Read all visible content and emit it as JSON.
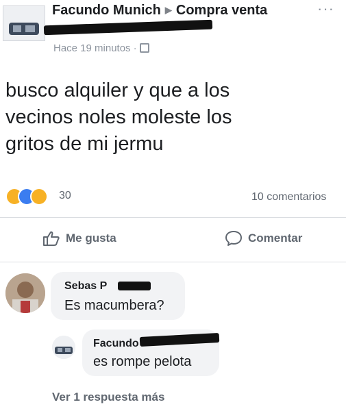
{
  "post": {
    "author": "Facundo Munich",
    "group": "Compra venta",
    "timestamp": "Hace 19 minutos",
    "separator": "·",
    "text_lines": [
      "busco alquiler y que a los",
      "vecinos noles moleste los",
      "gritos de mi jermu"
    ],
    "reaction_count": "30",
    "comments_count": "10 comentarios",
    "reactions": [
      "haha-icon",
      "like-icon",
      "wow-icon"
    ]
  },
  "actions": {
    "like_label": "Me gusta",
    "comment_label": "Comentar"
  },
  "comments": [
    {
      "name": "Sebas P",
      "text": "Es macumbera?"
    }
  ],
  "replies": [
    {
      "name": "Facundo",
      "text": "es rompe pelota"
    }
  ],
  "footer": {
    "more_replies": "Ver 1 respuesta más"
  },
  "colors": {
    "text": "#1c1e21",
    "secondary": "#606770",
    "muted": "#8d949e",
    "bubble": "#f2f3f5",
    "like_blue": "#3b7df0",
    "reaction_yellow": "#f7b125"
  }
}
